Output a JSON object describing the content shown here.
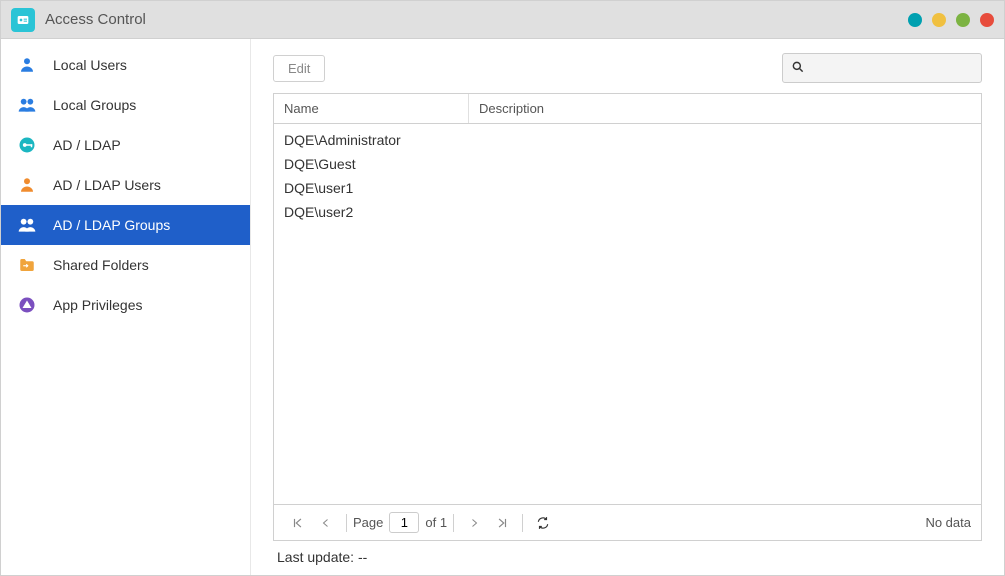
{
  "title": "Access Control",
  "window_dots": [
    "teal",
    "yellow",
    "green",
    "red"
  ],
  "sidebar": {
    "items": [
      {
        "label": "Local Users",
        "icon": "user-icon",
        "icon_color": "#2a7de1",
        "active": false
      },
      {
        "label": "Local Groups",
        "icon": "group-icon",
        "icon_color": "#2a7de1",
        "active": false
      },
      {
        "label": "AD / LDAP",
        "icon": "key-icon",
        "icon_color": "#1bb6c1",
        "active": false
      },
      {
        "label": "AD / LDAP Users",
        "icon": "user-icon",
        "icon_color": "#f08c2e",
        "active": false
      },
      {
        "label": "AD / LDAP Groups",
        "icon": "group-icon",
        "icon_color": "#f08c2e",
        "active": true
      },
      {
        "label": "Shared Folders",
        "icon": "folder-icon",
        "icon_color": "#f0a43c",
        "active": false
      },
      {
        "label": "App Privileges",
        "icon": "app-icon",
        "icon_color": "#7b4fbf",
        "active": false
      }
    ]
  },
  "toolbar": {
    "edit_label": "Edit",
    "search_placeholder": ""
  },
  "table": {
    "columns": {
      "name": "Name",
      "description": "Description"
    },
    "rows": [
      {
        "name": "DQE\\Administrator",
        "description": ""
      },
      {
        "name": "DQE\\Guest",
        "description": ""
      },
      {
        "name": "DQE\\user1",
        "description": ""
      },
      {
        "name": "DQE\\user2",
        "description": ""
      }
    ]
  },
  "pager": {
    "page_label": "Page",
    "current_page": "1",
    "total_pages_label": "of 1",
    "status": "No data"
  },
  "last_update_label": "Last update: --"
}
